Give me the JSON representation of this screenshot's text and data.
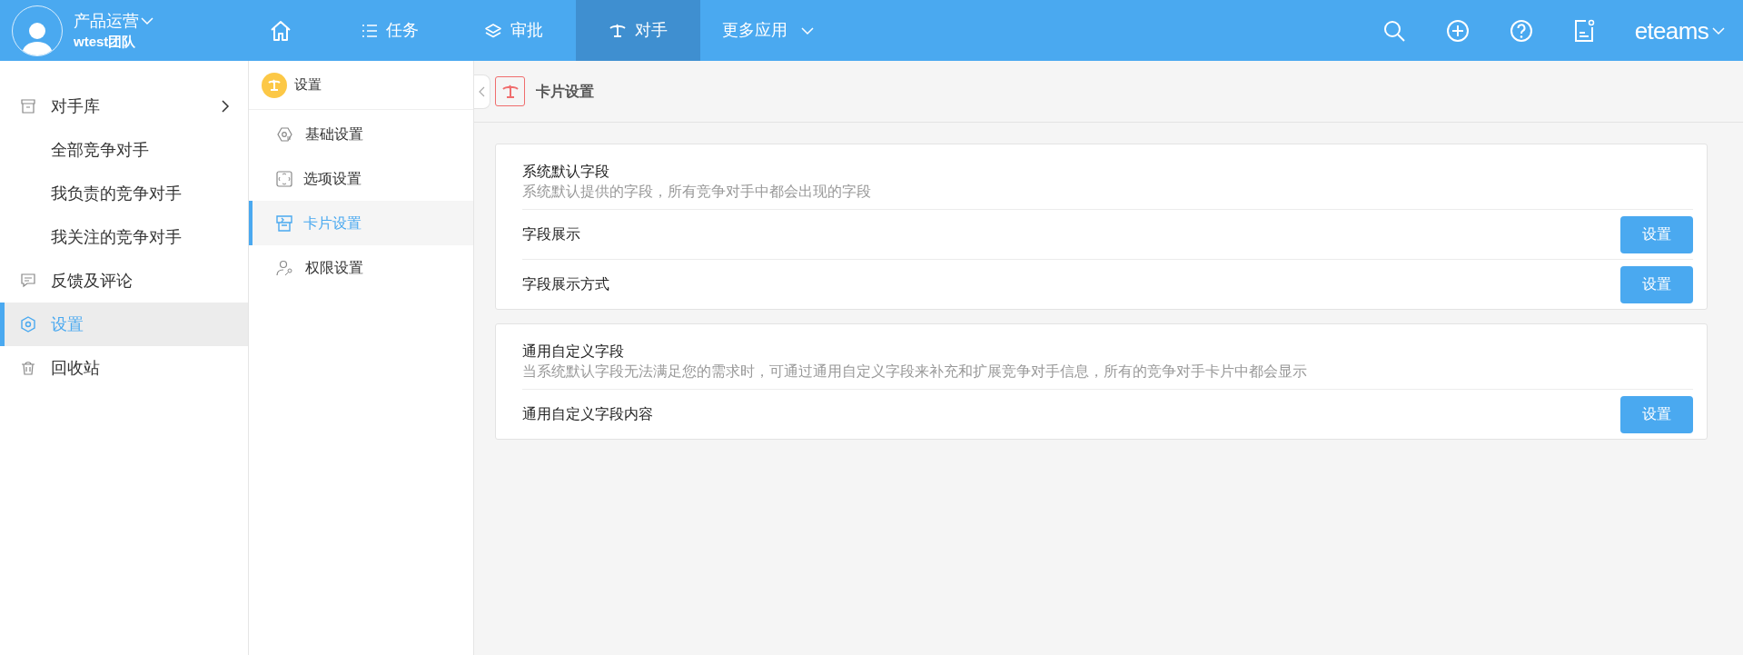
{
  "header": {
    "user_name": "产品运营",
    "team": "wtest团队",
    "nav": [
      {
        "kind": "home",
        "selected": false
      },
      {
        "kind": "list",
        "label": "任务",
        "selected": false
      },
      {
        "kind": "layers",
        "label": "审批",
        "selected": false
      },
      {
        "kind": "scale",
        "label": "对手",
        "selected": true
      },
      {
        "kind": "more",
        "label": "更多应用",
        "selected": false
      }
    ],
    "brand": "eteams"
  },
  "sidebar": {
    "items": [
      {
        "kind": "box",
        "label": "对手库",
        "selected": false,
        "expanded": true,
        "children": [
          {
            "label": "全部竞争对手",
            "selected": false
          },
          {
            "label": "我负责的竞争对手",
            "selected": false
          },
          {
            "label": "我关注的竞争对手",
            "selected": false
          }
        ]
      },
      {
        "kind": "comment",
        "label": "反馈及评论",
        "selected": false
      },
      {
        "kind": "settings",
        "label": "设置",
        "selected": true
      },
      {
        "kind": "trash",
        "label": "回收站",
        "selected": false
      }
    ]
  },
  "submenu": {
    "title": "设置",
    "items": [
      {
        "kind": "basic",
        "label": "基础设置",
        "selected": false
      },
      {
        "kind": "options",
        "label": "选项设置",
        "selected": false
      },
      {
        "kind": "card",
        "label": "卡片设置",
        "selected": true
      },
      {
        "kind": "permission",
        "label": "权限设置",
        "selected": false
      }
    ]
  },
  "main": {
    "title": "卡片设置",
    "sections": [
      {
        "title": "系统默认字段",
        "description": "系统默认提供的字段，所有竞争对手中都会出现的字段",
        "rows": [
          {
            "label": "字段展示",
            "button": "设置"
          },
          {
            "label": "字段展示方式",
            "button": "设置"
          }
        ]
      },
      {
        "title": "通用自定义字段",
        "description": "当系统默认字段无法满足您的需求时，可通过通用自定义字段来补充和扩展竞争对手信息，所有的竞争对手卡片中都会显示",
        "rows": [
          {
            "label": "通用自定义字段内容",
            "button": "设置"
          }
        ]
      }
    ]
  }
}
